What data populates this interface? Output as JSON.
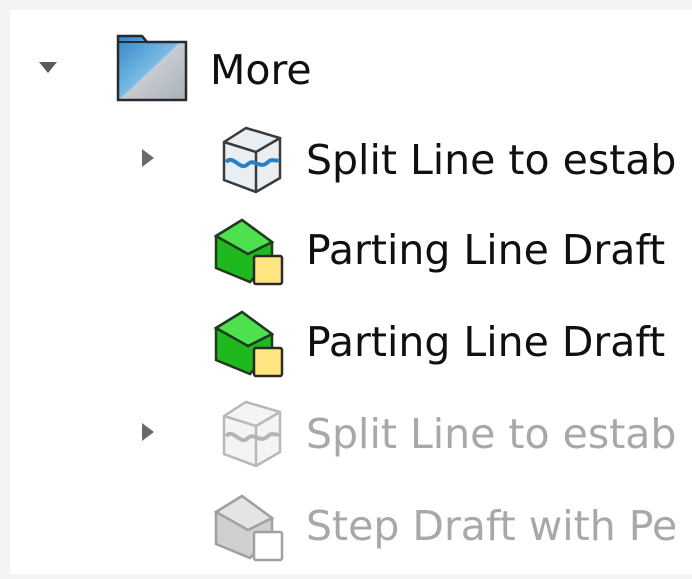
{
  "feature_tree": {
    "folder": {
      "label": "More",
      "expanded": true,
      "icon": "folder-icon"
    },
    "items": [
      {
        "label": "Split Line to estab",
        "icon": "split-line-icon",
        "has_children": true,
        "suppressed": false
      },
      {
        "label": "Parting Line Draft",
        "icon": "draft-icon",
        "has_children": false,
        "suppressed": false
      },
      {
        "label": "Parting Line Draft",
        "icon": "draft-icon",
        "has_children": false,
        "suppressed": false
      },
      {
        "label": "Split Line to estab",
        "icon": "split-line-icon",
        "has_children": true,
        "suppressed": true
      },
      {
        "label": "Step Draft with Pe",
        "icon": "draft-icon",
        "has_children": false,
        "suppressed": true
      }
    ]
  },
  "colors": {
    "text": "#101010",
    "suppressed_text": "#a8a8a8",
    "draft_green": "#1fb81f",
    "folder_blue": "#4d9fd8"
  }
}
